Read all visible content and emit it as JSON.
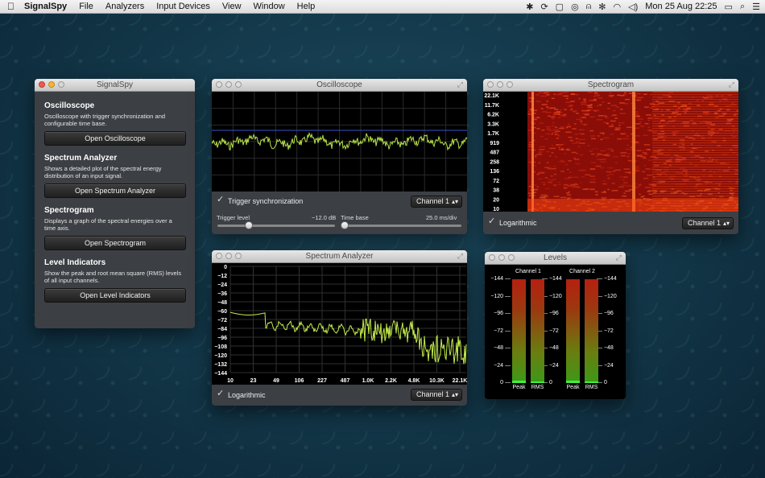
{
  "menubar": {
    "apple": "",
    "app_name": "SignalSpy",
    "menus": [
      "File",
      "Analyzers",
      "Input Devices",
      "View",
      "Window",
      "Help"
    ],
    "clock": "Mon 25 Aug  22:25"
  },
  "launcher": {
    "title": "SignalSpy",
    "sections": [
      {
        "heading": "Oscilloscope",
        "description": "Oscilloscope with trigger synchronization and configurable time base.",
        "button": "Open Oscilloscope"
      },
      {
        "heading": "Spectrum Analyzer",
        "description": "Shows a detailed plot of the spectral energy distribution of an input signal.",
        "button": "Open Spectrum Analyzer"
      },
      {
        "heading": "Spectrogram",
        "description": "Displays a graph of the spectral energies over a time axis.",
        "button": "Open Spectrogram"
      },
      {
        "heading": "Level Indicators",
        "description": "Show the peak and root mean square (RMS) levels of all input channels.",
        "button": "Open Level Indicators"
      }
    ]
  },
  "oscilloscope": {
    "title": "Oscilloscope",
    "trigger_sync_label": "Trigger synchronization",
    "trigger_sync_checked": true,
    "channel": "Channel 1",
    "trigger_level_label": "Trigger level",
    "trigger_level_value": "−12.0 dB",
    "time_base_label": "Time base",
    "time_base_value": "25.0 ms/div",
    "trigger_slider_fraction": 0.27,
    "timebase_slider_fraction": 0.03
  },
  "spectrogram": {
    "title": "Spectrogram",
    "logarithmic_label": "Logarithmic",
    "logarithmic_checked": true,
    "channel": "Channel 1",
    "freq_ticks": [
      "22.1K",
      "11.7K",
      "6.2K",
      "3.3K",
      "1.7K",
      "919",
      "487",
      "258",
      "136",
      "72",
      "38",
      "20",
      "10"
    ]
  },
  "spectrum": {
    "title": "Spectrum Analyzer",
    "logarithmic_label": "Logarithmic",
    "logarithmic_checked": true,
    "channel": "Channel 1",
    "db_ticks": [
      "0",
      "−12",
      "−24",
      "−36",
      "−48",
      "−60",
      "−72",
      "−84",
      "−96",
      "−108",
      "−120",
      "−132",
      "−144"
    ],
    "freq_ticks": [
      "10",
      "23",
      "49",
      "106",
      "227",
      "487",
      "1.0K",
      "2.2K",
      "4.8K",
      "10.3K",
      "22.1K"
    ]
  },
  "levels": {
    "title": "Levels",
    "channels": [
      "Channel 1",
      "Channel 2"
    ],
    "scale": [
      "−144",
      "−120",
      "−96",
      "−72",
      "−48",
      "−24",
      "0"
    ],
    "bar_labels": [
      "Peak",
      "RMS",
      "Peak",
      "RMS"
    ],
    "bar_levels": [
      0.02,
      0.01,
      0.02,
      0.01
    ]
  }
}
